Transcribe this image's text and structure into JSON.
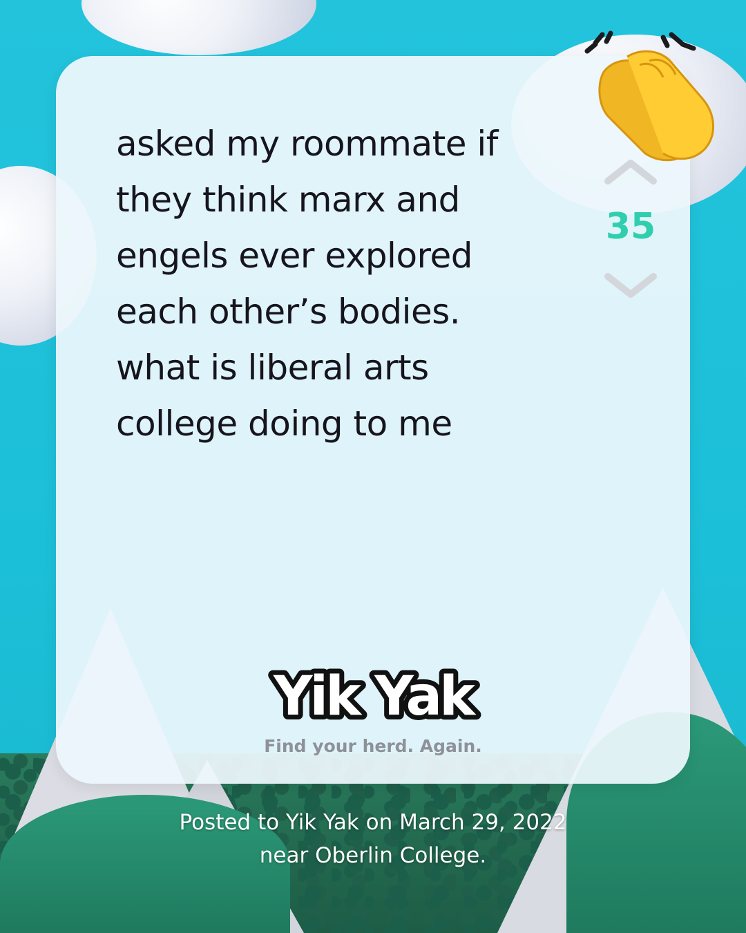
{
  "post": {
    "text_lines": [
      "asked my roommate if",
      "they think marx and",
      "engels ever explored",
      "each other’s bodies.",
      "what is liberal arts",
      "college doing to me"
    ],
    "vote_count": "35"
  },
  "icons": {
    "upvote": "chevron-up-icon",
    "downvote": "chevron-down-icon",
    "reaction": "clapping-hands-icon"
  },
  "brand": {
    "logo_text": "Yik Yak",
    "tagline": "Find your herd. Again."
  },
  "caption": {
    "line1": "Posted to Yik Yak on March 29, 2022",
    "line2": "near Oberlin College."
  },
  "colors": {
    "sky": "#1ec0d8",
    "vote_count": "#2fcfae",
    "card": "#ecf7fc",
    "text": "#16141c",
    "tagline": "#8e9198"
  }
}
